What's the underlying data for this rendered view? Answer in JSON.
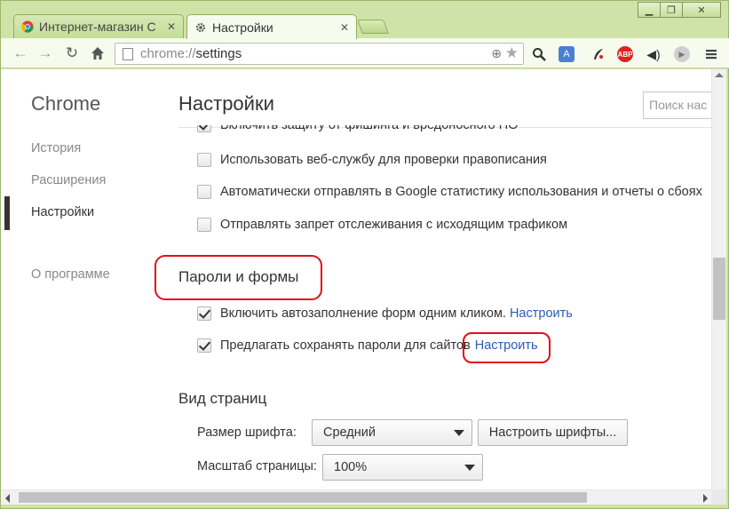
{
  "window": {
    "controls": {
      "minimize": "▁",
      "restore": "❐",
      "close": "✕"
    }
  },
  "tabs": [
    {
      "title": "Интернет-магазин С",
      "favicon": "chrome-logo-icon"
    },
    {
      "title": "Настройки",
      "favicon": "gear-icon"
    }
  ],
  "toolbar": {
    "url_scheme": "chrome://",
    "url_path": "settings",
    "extensions": [
      "search-icon",
      "translate-icon",
      "feather-icon",
      "adblock-icon",
      "audio-icon",
      "play-icon",
      "menu-icon"
    ],
    "adblock_label": "ABP"
  },
  "sidebar": {
    "brand": "Chrome",
    "items": [
      {
        "label": "История"
      },
      {
        "label": "Расширения"
      },
      {
        "label": "Настройки"
      },
      {
        "label": "О программе"
      }
    ]
  },
  "main": {
    "title": "Настройки",
    "search_placeholder": "Поиск нас",
    "privacy_rows": [
      {
        "label": "Включить защиту от фишинга и вредоносного ПО",
        "checked": true
      },
      {
        "label": "Использовать веб-службу для проверки правописания",
        "checked": false
      },
      {
        "label": "Автоматически отправлять в Google статистику использования и отчеты о сбоях",
        "checked": false
      },
      {
        "label": "Отправлять запрет отслеживания с исходящим трафиком",
        "checked": false
      }
    ],
    "passwords_section": {
      "title": "Пароли и формы",
      "rows": [
        {
          "label": "Включить автозаполнение форм одним кликом.",
          "link": "Настроить",
          "checked": true
        },
        {
          "label": "Предлагать сохранять пароли для сайтов",
          "link": "Настроить",
          "checked": true
        }
      ]
    },
    "appearance_section": {
      "title": "Вид страниц",
      "font_size_label": "Размер шрифта:",
      "font_size_value": "Средний",
      "fonts_button": "Настроить шрифты...",
      "zoom_label": "Масштаб страницы:",
      "zoom_value": "100%"
    }
  },
  "colors": {
    "frame": "#cfe3a8",
    "link": "#2a5db0",
    "highlight": "#e0101a"
  }
}
